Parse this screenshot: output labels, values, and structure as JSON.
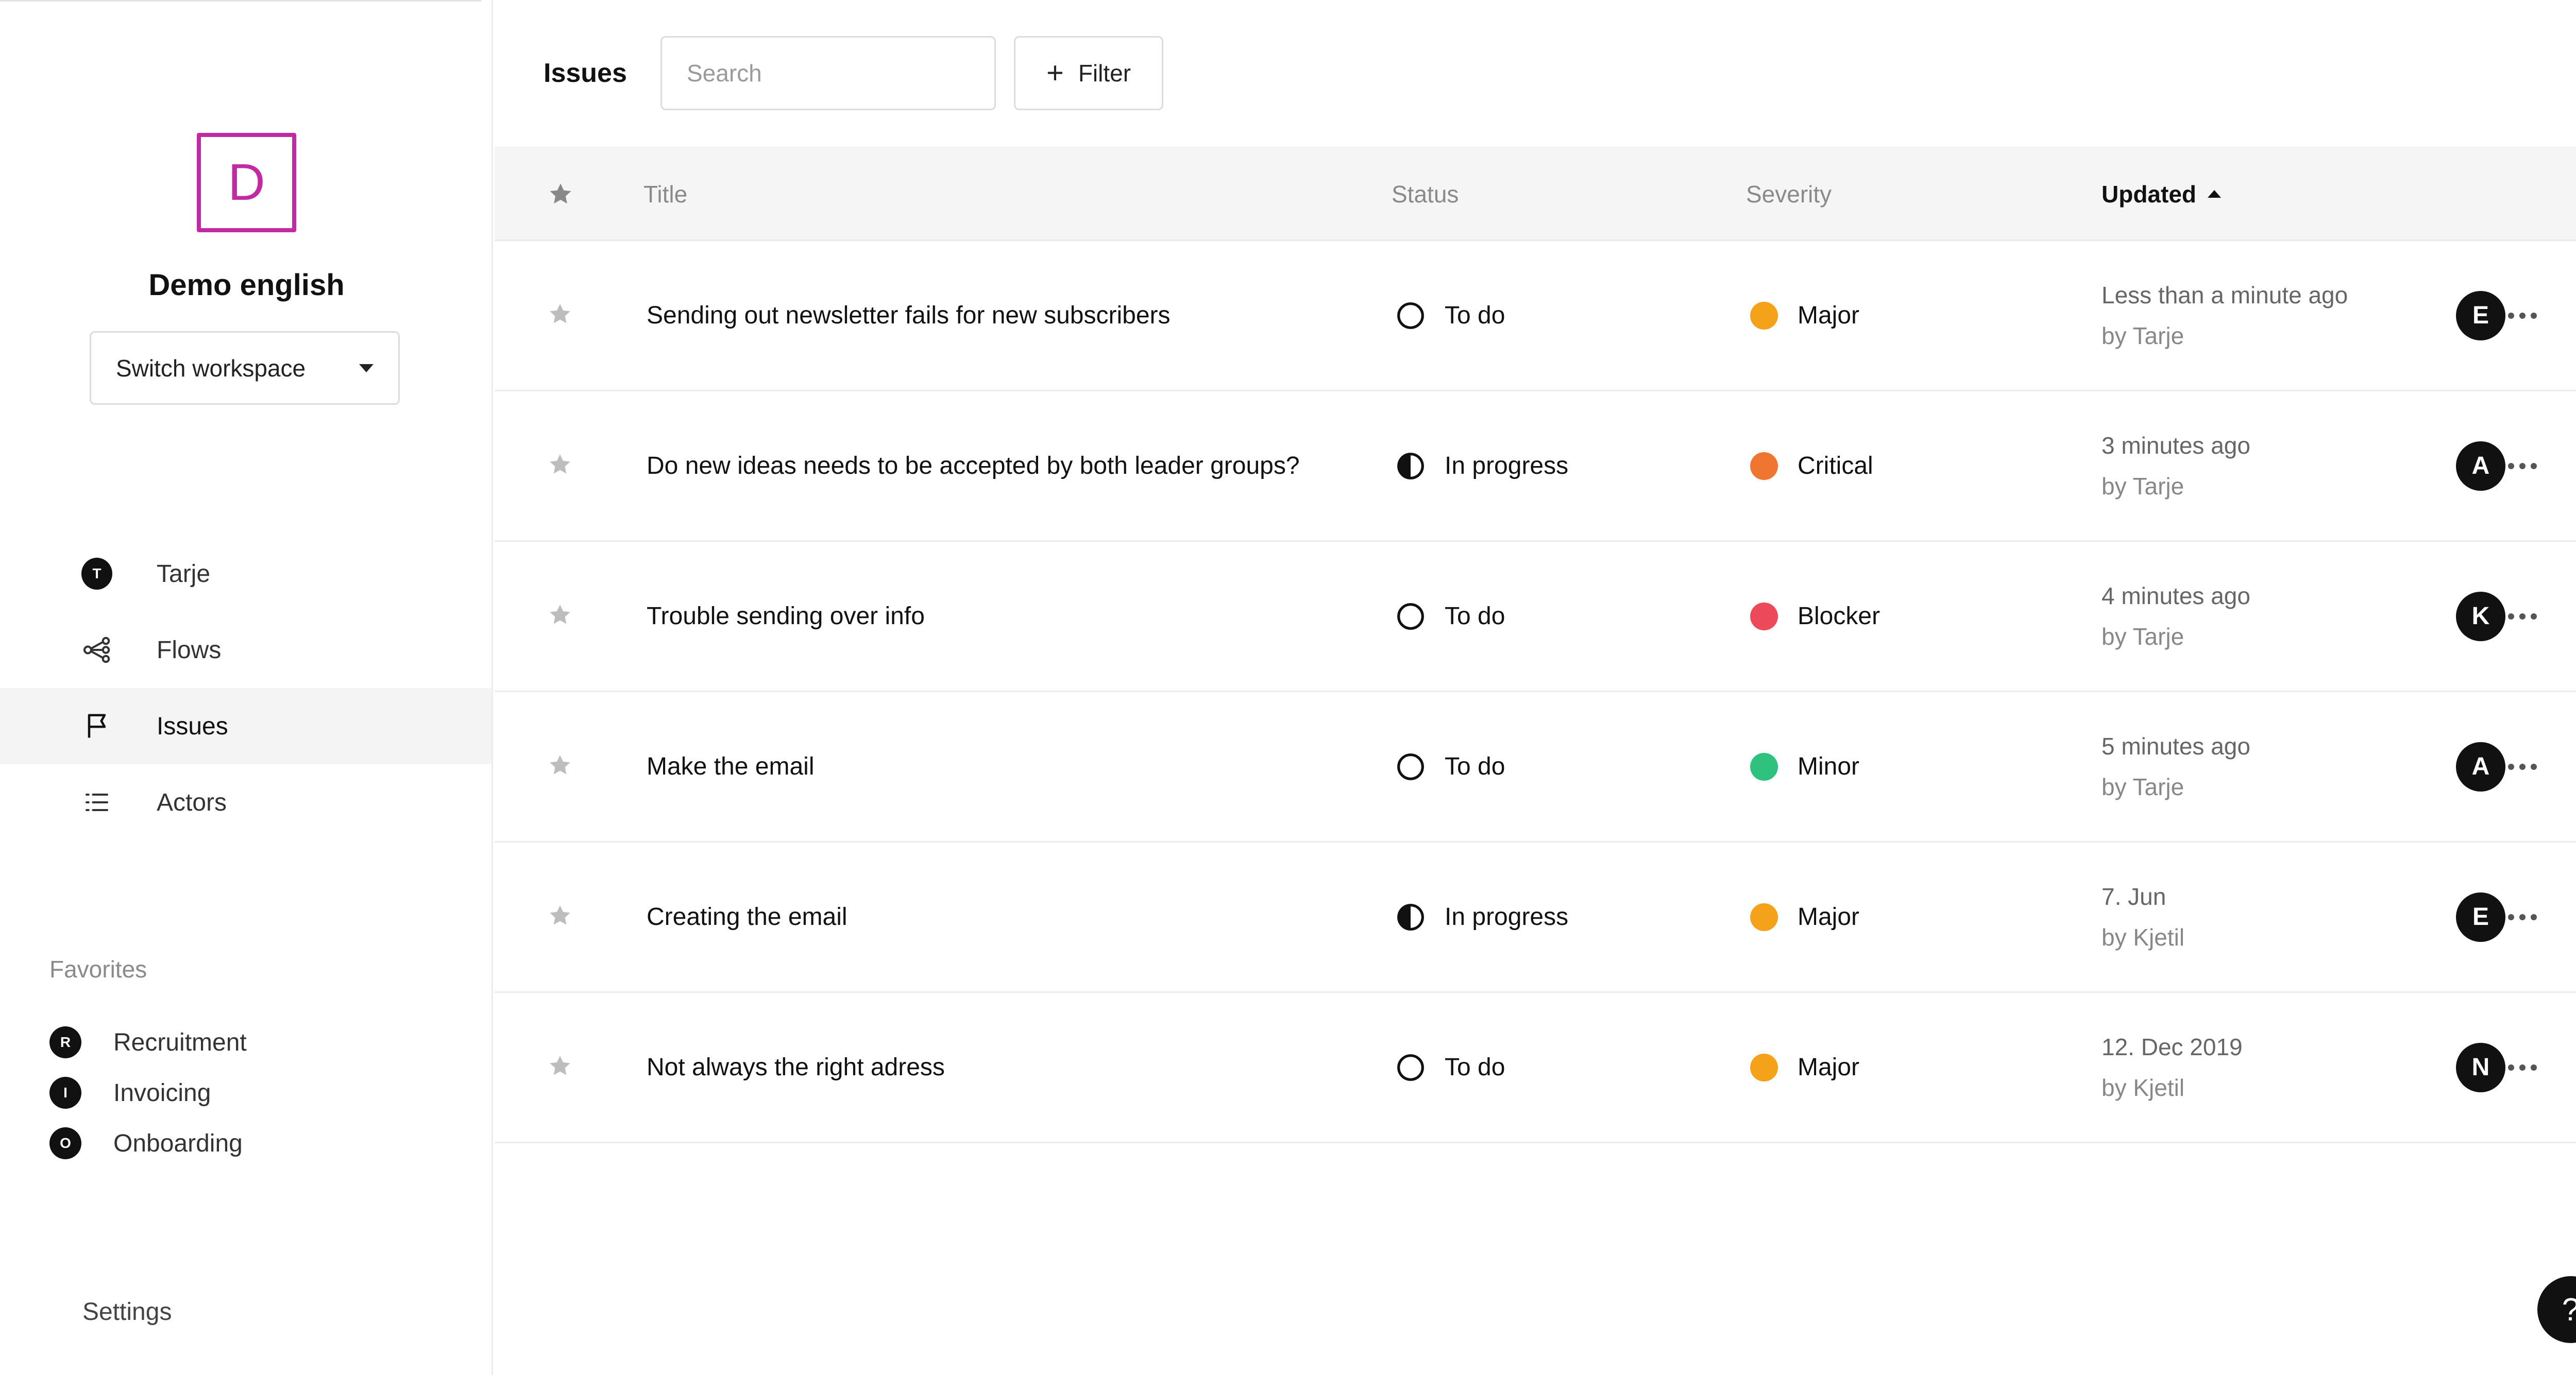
{
  "colors": {
    "brand": "#c22aa4",
    "severity_major": "#f5a21b",
    "severity_critical": "#f07530",
    "severity_blocker": "#ec4a5a",
    "severity_minor": "#2ec27e"
  },
  "workspace": {
    "logo_letter": "D",
    "name": "Demo english",
    "switch_label": "Switch workspace"
  },
  "nav": {
    "items": [
      {
        "label": "Tarje",
        "icon": "user-avatar-icon",
        "avatar": "T"
      },
      {
        "label": "Flows",
        "icon": "flows-icon"
      },
      {
        "label": "Issues",
        "icon": "flag-icon"
      },
      {
        "label": "Actors",
        "icon": "list-icon"
      }
    ]
  },
  "favorites": {
    "title": "Favorites",
    "items": [
      {
        "label": "Recruitment",
        "avatar": "R"
      },
      {
        "label": "Invoicing",
        "avatar": "I"
      },
      {
        "label": "Onboarding",
        "avatar": "O"
      }
    ]
  },
  "settings_label": "Settings",
  "header": {
    "title": "Issues",
    "search_placeholder": "Search",
    "filter_label": "Filter"
  },
  "table": {
    "columns": {
      "title": "Title",
      "status": "Status",
      "severity": "Severity",
      "updated": "Updated"
    },
    "rows": [
      {
        "title": "Sending out newsletter fails for new subscribers",
        "status": "To do",
        "status_icon": "todo-circle-icon",
        "severity": "Major",
        "severity_color": "#f5a21b",
        "updated": "Less than a minute ago",
        "by": "by Tarje",
        "assignee": "E"
      },
      {
        "title": "Do new ideas needs to be accepted by both leader groups?",
        "status": "In progress",
        "status_icon": "half-circle-icon",
        "severity": "Critical",
        "severity_color": "#f07530",
        "updated": "3 minutes ago",
        "by": "by Tarje",
        "assignee": "A"
      },
      {
        "title": "Trouble sending over info",
        "status": "To do",
        "status_icon": "todo-circle-icon",
        "severity": "Blocker",
        "severity_color": "#ec4a5a",
        "updated": "4 minutes ago",
        "by": "by Tarje",
        "assignee": "K"
      },
      {
        "title": "Make the email",
        "status": "To do",
        "status_icon": "todo-circle-icon",
        "severity": "Minor",
        "severity_color": "#2ec27e",
        "updated": "5 minutes ago",
        "by": "by Tarje",
        "assignee": "A"
      },
      {
        "title": "Creating the email",
        "status": "In progress",
        "status_icon": "half-circle-icon",
        "severity": "Major",
        "severity_color": "#f5a21b",
        "updated": "7. Jun",
        "by": "by Kjetil",
        "assignee": "E"
      },
      {
        "title": "Not always the right adress",
        "status": "To do",
        "status_icon": "todo-circle-icon",
        "severity": "Major",
        "severity_color": "#f5a21b",
        "updated": "12. Dec 2019",
        "by": "by Kjetil",
        "assignee": "N"
      }
    ]
  },
  "help_label": "?"
}
